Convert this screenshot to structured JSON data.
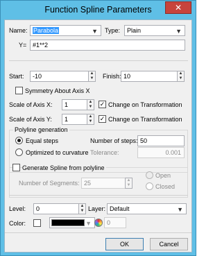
{
  "window": {
    "title": "Function Spline Parameters",
    "close_glyph": "✕"
  },
  "name": {
    "label": "Name:",
    "value": "Parabola"
  },
  "type": {
    "label": "Type:",
    "value": "Plain"
  },
  "formula": {
    "label": "Y=",
    "value": "#1**2"
  },
  "start": {
    "label": "Start:",
    "value": "-10"
  },
  "finish": {
    "label": "Finish:",
    "value": "10"
  },
  "symmetry": {
    "label": "Symmetry About Axis X",
    "checked": false
  },
  "scale_x": {
    "label": "Scale of Axis X:",
    "value": "1",
    "change_label": "Change on Transformation",
    "change_checked": true
  },
  "scale_y": {
    "label": "Scale of Axis Y:",
    "value": "1",
    "change_label": "Change on Transformation",
    "change_checked": true
  },
  "polyline": {
    "title": "Polyline generation",
    "equal_steps": "Equal steps",
    "optimized": "Optimized to curvature",
    "selected": "equal_steps",
    "steps_label": "Number of steps:",
    "steps_value": "50",
    "tolerance_label": "Tolerance:",
    "tolerance_value": "0.001"
  },
  "spline": {
    "title": "Generate Spline from polyline",
    "checked": false,
    "segments_label": "Number of Segments:",
    "segments_value": "25",
    "open_label": "Open",
    "closed_label": "Closed",
    "selected": "open"
  },
  "level": {
    "label": "Level:",
    "value": "0"
  },
  "layer": {
    "label": "Layer:",
    "value": "Default"
  },
  "color": {
    "label": "Color:",
    "swatch": "#000000",
    "value": "0"
  },
  "buttons": {
    "ok": "OK",
    "cancel": "Cancel"
  },
  "icons": {
    "combo_arrow": "chevron-down-icon",
    "spin_up": "caret-up-icon",
    "spin_down": "caret-down-icon",
    "checkmark": "checkmark-icon",
    "palette": "palette-icon"
  }
}
